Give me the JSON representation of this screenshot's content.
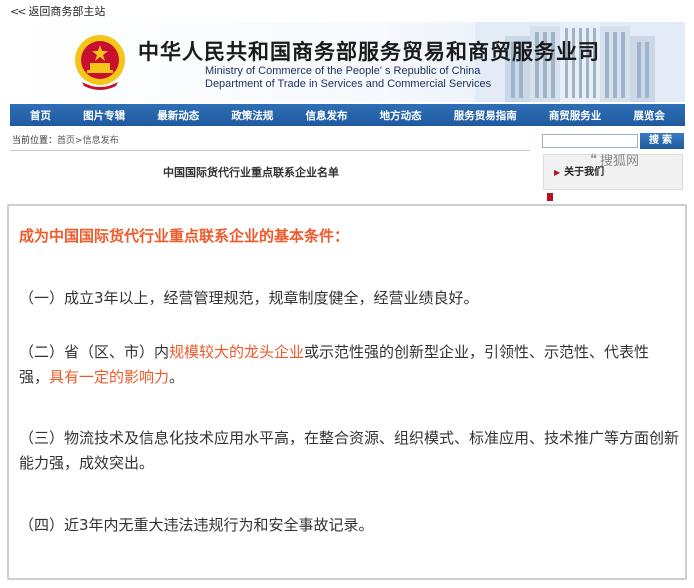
{
  "topbar": {
    "back_label": "返回商务部主站",
    "back_icon": "double-chevron-left-icon"
  },
  "banner": {
    "title_cn": "中华人民共和国商务部服务贸易和商贸服务业司",
    "title_en_line1": "Ministry of Commerce of the People' s Republic of China",
    "title_en_line2": "Department of Trade in Services and Commercial Services",
    "emblem_icon": "national-emblem-icon",
    "building_image": "ministry-building-image"
  },
  "nav": {
    "items": [
      "首页",
      "图片专辑",
      "最新动态",
      "政策法规",
      "信息发布",
      "地方动态",
      "服务贸易指南",
      "商贸服务业",
      "展览会"
    ]
  },
  "breadcrumb": {
    "label": "当前位置：",
    "home": "首页",
    "sep": ">",
    "current": "信息发布"
  },
  "search": {
    "placeholder": "",
    "button_label": "搜索"
  },
  "list": {
    "title": "中国国际货代行业重点联系企业名单"
  },
  "about": {
    "label": "关于我们"
  },
  "watermark": {
    "text": "搜狐网",
    "icon": "sohu-logo-icon"
  },
  "article": {
    "heading": "成为中国国际货代行业重点联系企业的基本条件：",
    "p1": "（一）成立3年以上，经营管理规范，规章制度健全，经营业绩良好。",
    "p2_a": "（二）省（区、市）内",
    "p2_hl1": "规模较大的龙头企业",
    "p2_b": "或示范性强的创新型企业，引领性、示范性、代表性强，",
    "p2_hl2": "具有一定的影响力",
    "p2_c": "。",
    "p3": "（三）物流技术及信息化技术应用水平高，在整合资源、组织模式、标准应用、技术推广等方面创新能力强，成效突出。",
    "p4": "（四）近3年内无重大违法违规行为和安全事故记录。"
  },
  "colors": {
    "accent": "#ef5a2b",
    "nav_blue": "#1f5aa0",
    "emblem_red": "#c8102e",
    "emblem_gold": "#f5c518"
  }
}
